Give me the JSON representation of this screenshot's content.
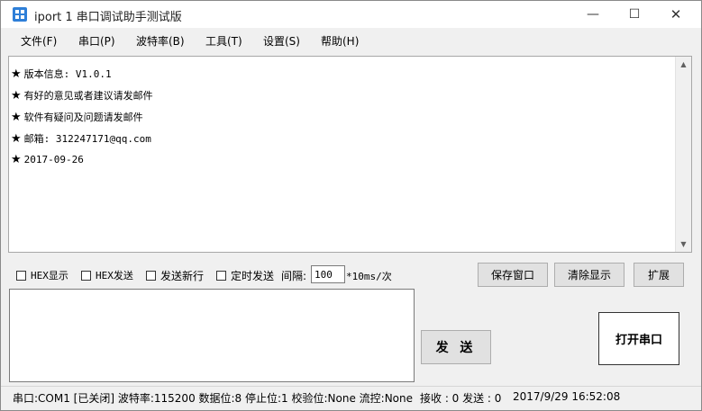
{
  "window": {
    "title": "iport 1 串口调试助手测试版",
    "minimize_glyph": "—",
    "maximize_glyph": "☐",
    "close_glyph": "✕"
  },
  "menu": [
    "文件(F)",
    "串口(P)",
    "波特率(B)",
    "工具(T)",
    "设置(S)",
    "帮助(H)"
  ],
  "receive": {
    "bullet": "★",
    "lines": [
      "版本信息: V1.0.1",
      "有好的意见或者建议请发邮件",
      "软件有疑问及问题请发邮件",
      "邮箱: 312247171@qq.com",
      "2017-09-26"
    ]
  },
  "options": {
    "hex_display": "HEX显示",
    "hex_send": "HEX发送",
    "send_newline": "发送新行",
    "timed_send": "定时发送",
    "interval_label": "间隔:",
    "interval_value": "100",
    "interval_unit": "*10ms/次"
  },
  "buttons": {
    "save_window": "保存窗口",
    "clear_display": "清除显示",
    "expand": "扩展",
    "send": "发 送",
    "open_port": "打开串口"
  },
  "status": {
    "port_info": "串口:COM1 [已关闭] 波特率:115200 数据位:8 停止位:1 校验位:None 流控:None",
    "rx_tx": "接收 : 0 发送 : 0",
    "datetime": "2017/9/29 16:52:08"
  },
  "colors": {
    "icon": "#2e7fd8",
    "chrome": "#f0f0f0"
  }
}
